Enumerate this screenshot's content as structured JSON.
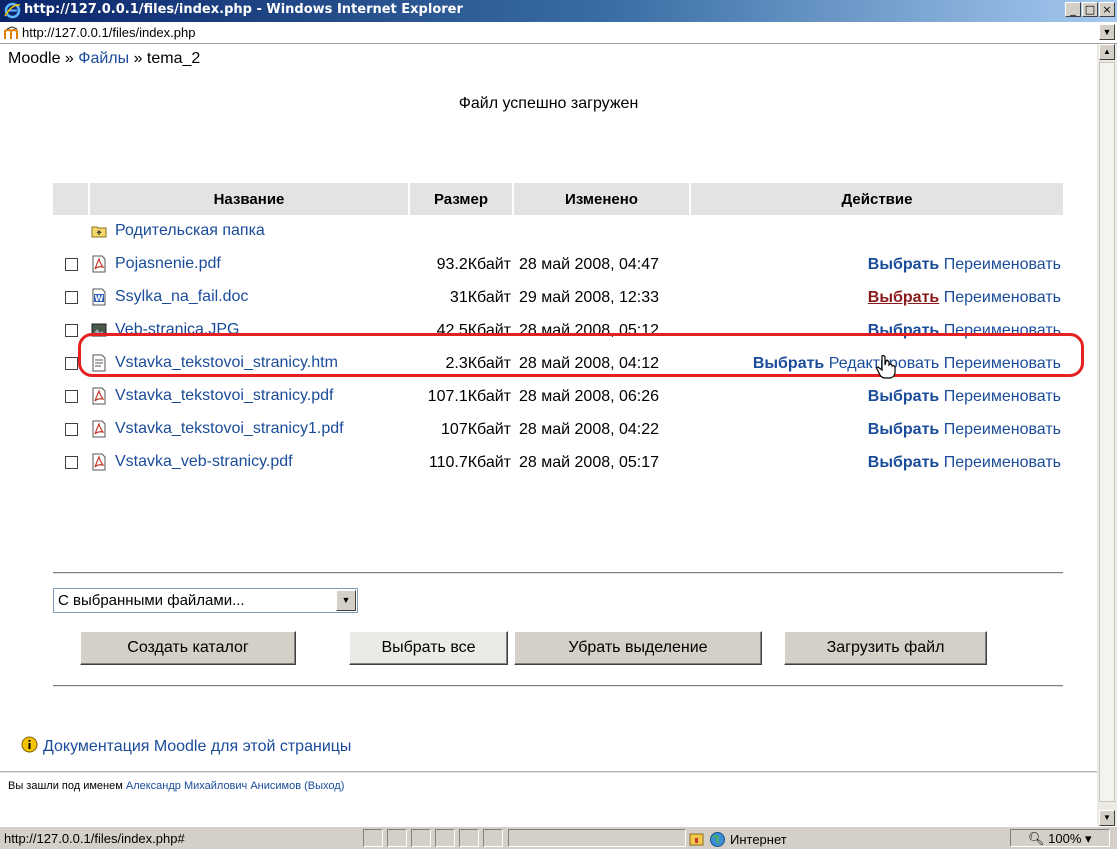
{
  "window": {
    "title": "http://127.0.0.1/files/index.php - Windows Internet Explorer",
    "address": "http://127.0.0.1/files/index.php"
  },
  "breadcrumb": {
    "home": "Moodle",
    "sep1": " » ",
    "files": "Файлы",
    "sep2": " » ",
    "current": "tema_2"
  },
  "message": "Файл успешно загружен",
  "table": {
    "headers": [
      "Название",
      "Размер",
      "Изменено",
      "Действие"
    ],
    "parent_folder": "Родительская папка",
    "rows": [
      {
        "name": "Pojasnenie.pdf",
        "type": "pdf",
        "size": "93.2Кбайт",
        "modified": "28 май 2008, 04:47",
        "actions": [
          "Выбрать",
          "Переименовать"
        ]
      },
      {
        "name": "Ssylka_na_fail.doc",
        "type": "doc",
        "size": "31Кбайт",
        "modified": "29 май 2008, 12:33",
        "actions": [
          "Выбрать",
          "Переименовать"
        ]
      },
      {
        "name": "Veb-stranica.JPG",
        "type": "jpg",
        "size": "42.5Кбайт",
        "modified": "28 май 2008, 05:12",
        "actions": [
          "Выбрать",
          "Переименовать"
        ]
      },
      {
        "name": "Vstavka_tekstovoi_stranicy.htm",
        "type": "htm",
        "size": "2.3Кбайт",
        "modified": "28 май 2008, 04:12",
        "actions": [
          "Выбрать",
          "Редактировать",
          "Переименовать"
        ]
      },
      {
        "name": "Vstavka_tekstovoi_stranicy.pdf",
        "type": "pdf",
        "size": "107.1Кбайт",
        "modified": "28 май 2008, 06:26",
        "actions": [
          "Выбрать",
          "Переименовать"
        ]
      },
      {
        "name": "Vstavka_tekstovoi_stranicy1.pdf",
        "type": "pdf",
        "size": "107Кбайт",
        "modified": "28 май 2008, 04:22",
        "actions": [
          "Выбрать",
          "Переименовать"
        ]
      },
      {
        "name": "Vstavka_veb-stranicy.pdf",
        "type": "pdf",
        "size": "110.7Кбайт",
        "modified": "28 май 2008, 05:17",
        "actions": [
          "Выбрать",
          "Переименовать"
        ]
      }
    ]
  },
  "controls": {
    "with_selected": "С выбранными файлами...",
    "create_folder": "Создать каталог",
    "select_all": "Выбрать все",
    "deselect": "Убрать выделение",
    "upload": "Загрузить файл"
  },
  "footer": {
    "doc_link": "Документация Moodle для этой страницы",
    "logged_prefix": "Вы зашли под именем ",
    "user": "Александр Михайлович Анисимов",
    "logout": "(Выход)"
  },
  "status": {
    "url": "http://127.0.0.1/files/index.php#",
    "zone": "Интернет",
    "zoom": "100%"
  },
  "colors": {
    "link": "#1a4c9a",
    "highlight": "#e52020",
    "hovered_link": "#8b1a1a"
  }
}
